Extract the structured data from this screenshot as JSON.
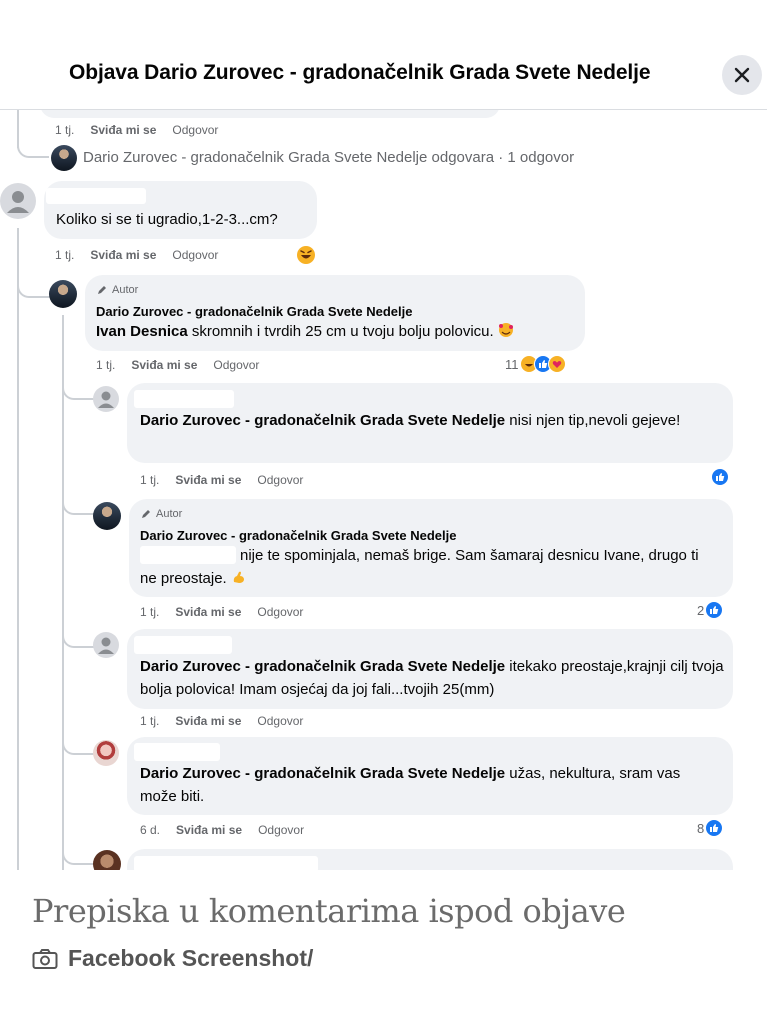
{
  "header": {
    "title": "Objava Dario Zurovec - gradonačelnik Grada Svete Nedelje"
  },
  "thread": {
    "top_actions": {
      "time": "1 tj.",
      "like": "Sviđa mi se",
      "reply": "Odgovor"
    },
    "reply_summary": "Dario Zurovec - gradonačelnik Grada Svete Nedelje odgovara · 1 odgovor",
    "comments": [
      {
        "text": "Koliko si se ti ugradio,1-2-3...cm?",
        "time": "1 tj.",
        "like": "Sviđa mi se",
        "reply": "Odgovor"
      },
      {
        "badge": "Autor",
        "author": "Dario Zurovec - gradonačelnik Grada Svete Nedelje",
        "mention": "Ivan Desnica",
        "text": " skromnih i tvrdih 25 cm u tvoju bolju polovicu.",
        "time": "1 tj.",
        "like": "Sviđa mi se",
        "reply": "Odgovor",
        "reaction_count": "11"
      },
      {
        "mention": "Dario Zurovec - gradonačelnik Grada Svete Nedelje",
        "text": " nisi njen tip,nevoli gejeve!",
        "time": "1 tj.",
        "like": "Sviđa mi se",
        "reply": "Odgovor"
      },
      {
        "badge": "Autor",
        "author": "Dario Zurovec - gradonačelnik Grada Svete Nedelje",
        "text": "nije te spominjala, nemaš brige. Sam šamaraj desnicu Ivane, drugo ti ne preostaje.",
        "time": "1 tj.",
        "like": "Sviđa mi se",
        "reply": "Odgovor",
        "reaction_count": "2"
      },
      {
        "mention": "Dario Zurovec - gradonačelnik Grada Svete Nedelje",
        "text": " itekako preostaje,krajnji cilj tvoja bolja polovica! Imam osjećaj da joj fali...tvojih 25(mm)",
        "time": "1 tj.",
        "like": "Sviđa mi se",
        "reply": "Odgovor"
      },
      {
        "mention": "Dario Zurovec - gradonačelnik Grada Svete Nedelje",
        "text": " užas, nekultura, sram vas može biti.",
        "time": "6 d.",
        "like": "Sviđa mi se",
        "reply": "Odgovor",
        "reaction_count": "8"
      }
    ]
  },
  "caption": {
    "title": "Prepiska u komentarima ispod objave",
    "credit": "Facebook Screenshot/"
  },
  "icons": {
    "close": "close-icon",
    "camera": "camera-icon",
    "author_badge": "pencil-icon",
    "like": "like-icon",
    "haha": "haha-icon",
    "care": "care-icon"
  },
  "colors": {
    "like_blue": "#1877f2",
    "bubble": "#f0f2f5",
    "secondary_text": "#65676b"
  }
}
